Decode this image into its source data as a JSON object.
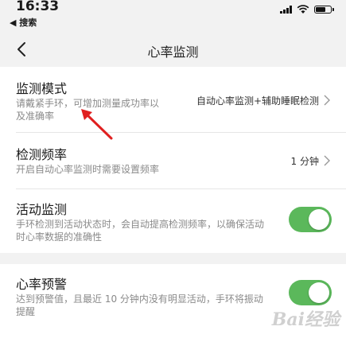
{
  "status_bar": {
    "time": "16:33",
    "back_app_label": "◀ 搜索"
  },
  "nav": {
    "title": "心率监测"
  },
  "settings": [
    {
      "title": "监测模式",
      "description": "请戴紧手环，可增加测量成功率以及准确率",
      "desc_line1": "请戴紧手环，可增加测量成功率以",
      "desc_line2": "及准确率",
      "value": "自动心率监测+辅助睡眠检测"
    },
    {
      "title": "检测频率",
      "description": "开启自动心率监测时需要设置频率",
      "value": "1 分钟"
    },
    {
      "title": "活动监测",
      "desc_line1": "手环检测到活动状态时，会自动提高检测频率，以确保活动",
      "desc_line2": "时心率数据的准确性",
      "toggle_on": true
    },
    {
      "title": "心率预警",
      "desc_line1": "达到预警值，且最近 10 分钟内没有明显活动，手环将振动",
      "desc_line2": "提醒",
      "toggle_on": true
    }
  ],
  "colors": {
    "toggle_on": "#5bb85b",
    "annotation_arrow": "#e02020",
    "background_gray": "#f2f2f2"
  },
  "icons": [
    "signal-icon",
    "wifi-icon",
    "battery-icon",
    "back-chevron-icon",
    "chevron-right-icon"
  ]
}
